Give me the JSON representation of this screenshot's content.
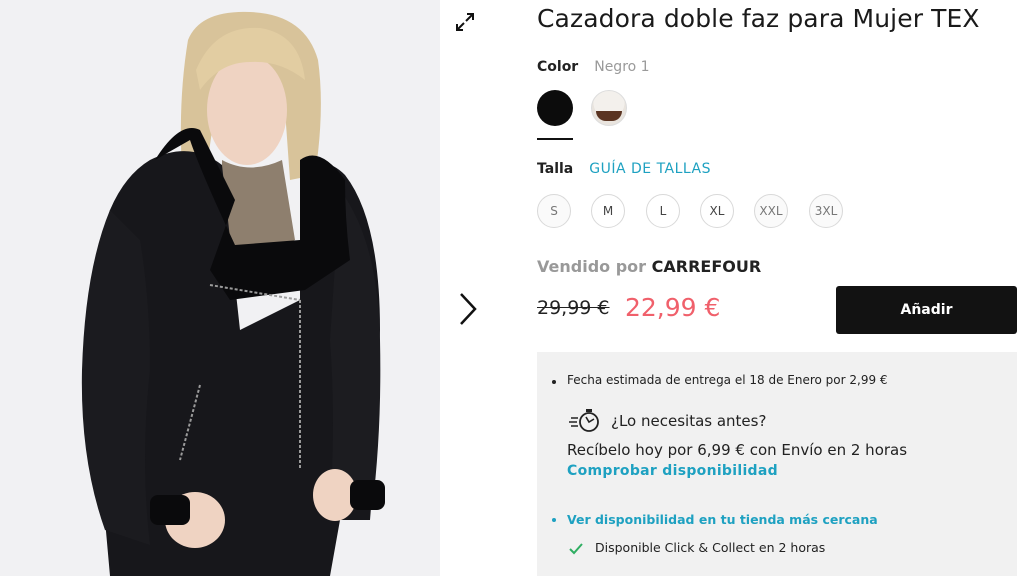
{
  "product": {
    "title": "Cazadora doble faz para Mujer TEX",
    "image_alt": "Mujer con cazadora negra doble faz"
  },
  "color": {
    "label": "Color",
    "selected": "Negro 1",
    "swatches": [
      "negro",
      "blanco-marron"
    ]
  },
  "size": {
    "label": "Talla",
    "guide_link": "GUÍA DE TALLAS",
    "options": [
      "S",
      "M",
      "L",
      "XL",
      "XXL",
      "3XL"
    ]
  },
  "seller": {
    "prefix": "Vendido por",
    "name": "CARREFOUR"
  },
  "price": {
    "old": "29,99 €",
    "current": "22,99 €"
  },
  "actions": {
    "add_label": "Añadir"
  },
  "delivery": {
    "estimate": "Fecha estimada de entrega el 18 de Enero por 2,99 €",
    "need_before": "¿Lo necesitas antes?",
    "receive_today": "Recíbelo hoy por 6,99 € con Envío en 2 horas",
    "check_availability": "Comprobar disponibilidad",
    "store_link": "Ver disponibilidad en tu tienda más cercana",
    "click_collect": "Disponible Click & Collect en 2 horas"
  },
  "colors": {
    "accent": "#1ea1c1",
    "sale_price": "#f0606b",
    "button_bg": "#121212",
    "panel_bg": "#f1f1f1"
  },
  "icons": {
    "expand": "expand-icon",
    "next": "chevron-right-icon",
    "timer": "stopwatch-icon",
    "check": "checkmark-icon"
  }
}
